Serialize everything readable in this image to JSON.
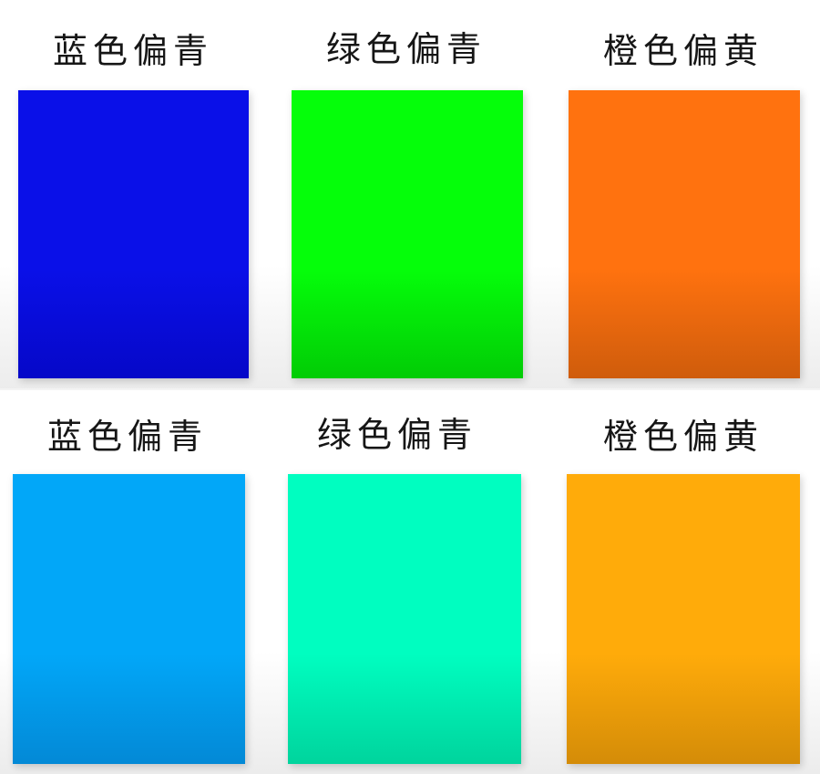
{
  "rows": [
    {
      "items": [
        {
          "label": "蓝色偏青",
          "color_top": "#0a10e8",
          "color_bottom": "#0608c8"
        },
        {
          "label": "绿色偏青",
          "color_top": "#05fe0a",
          "color_bottom": "#02cc06"
        },
        {
          "label": "橙色偏黄",
          "color_top": "#ff720f",
          "color_bottom": "#cf5c0c"
        }
      ]
    },
    {
      "items": [
        {
          "label": "蓝色偏青",
          "color_top": "#02a7f8",
          "color_bottom": "#0389d6"
        },
        {
          "label": "绿色偏青",
          "color_top": "#00fec0",
          "color_bottom": "#00d49d"
        },
        {
          "label": "橙色偏黄",
          "color_top": "#ffab0a",
          "color_bottom": "#d48c08"
        }
      ]
    }
  ]
}
